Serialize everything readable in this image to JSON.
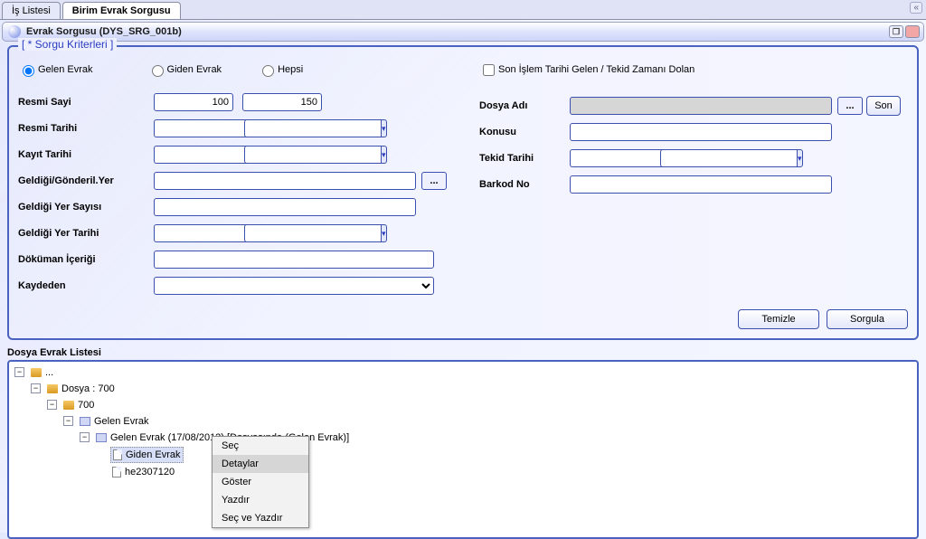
{
  "tabs": {
    "is_listesi": "İş Listesi",
    "birim_evrak": "Birim Evrak Sorgusu"
  },
  "tab_scroll_hint": "«",
  "window_title": "Evrak Sorgusu (DYS_SRG_001b)",
  "fieldset_title": "[ * Sorgu Kriterleri ]",
  "radios": {
    "gelen": "Gelen Evrak",
    "giden": "Giden Evrak",
    "hepsi": "Hepsi"
  },
  "labels": {
    "resmi_sayi": "Resmi Sayi",
    "resmi_tarihi": "Resmi Tarihi",
    "kayit_tarihi": "Kayıt Tarihi",
    "geldigi_gonderil": "Geldiği/Gönderil.Yer",
    "geldigi_yer_sayisi": "Geldiği Yer Sayısı",
    "geldigi_yer_tarihi": "Geldiği Yer Tarihi",
    "dokuman_icerigi": "Döküman İçeriği",
    "kaydeden": "Kaydeden",
    "son_islem": "Son İşlem Tarihi Gelen / Tekid Zamanı Dolan",
    "dosya_adi": "Dosya Adı",
    "konusu": "Konusu",
    "tekid_tarihi": "Tekid Tarihi",
    "barkod_no": "Barkod No"
  },
  "values": {
    "resmi_sayi_from": "100",
    "resmi_sayi_to": "150"
  },
  "buttons": {
    "browse": "...",
    "son": "Son",
    "temizle": "Temizle",
    "sorgula": "Sorgula"
  },
  "tree_title": "Dosya Evrak Listesi",
  "tree": {
    "root": "...",
    "dosya700": "Dosya : 700",
    "n700": "700",
    "gelen": "Gelen Evrak",
    "gelen_dated": "Gelen Evrak (17/08/2012) [Dosyasında (Gelen Evrak)]",
    "giden_leaf": "Giden Evrak",
    "he_file": "he2307120"
  },
  "context_menu": {
    "sec": "Seç",
    "detaylar": "Detaylar",
    "goster": "Göster",
    "yazdir": "Yazdır",
    "sec_ve_yazdir": "Seç ve Yazdır"
  }
}
